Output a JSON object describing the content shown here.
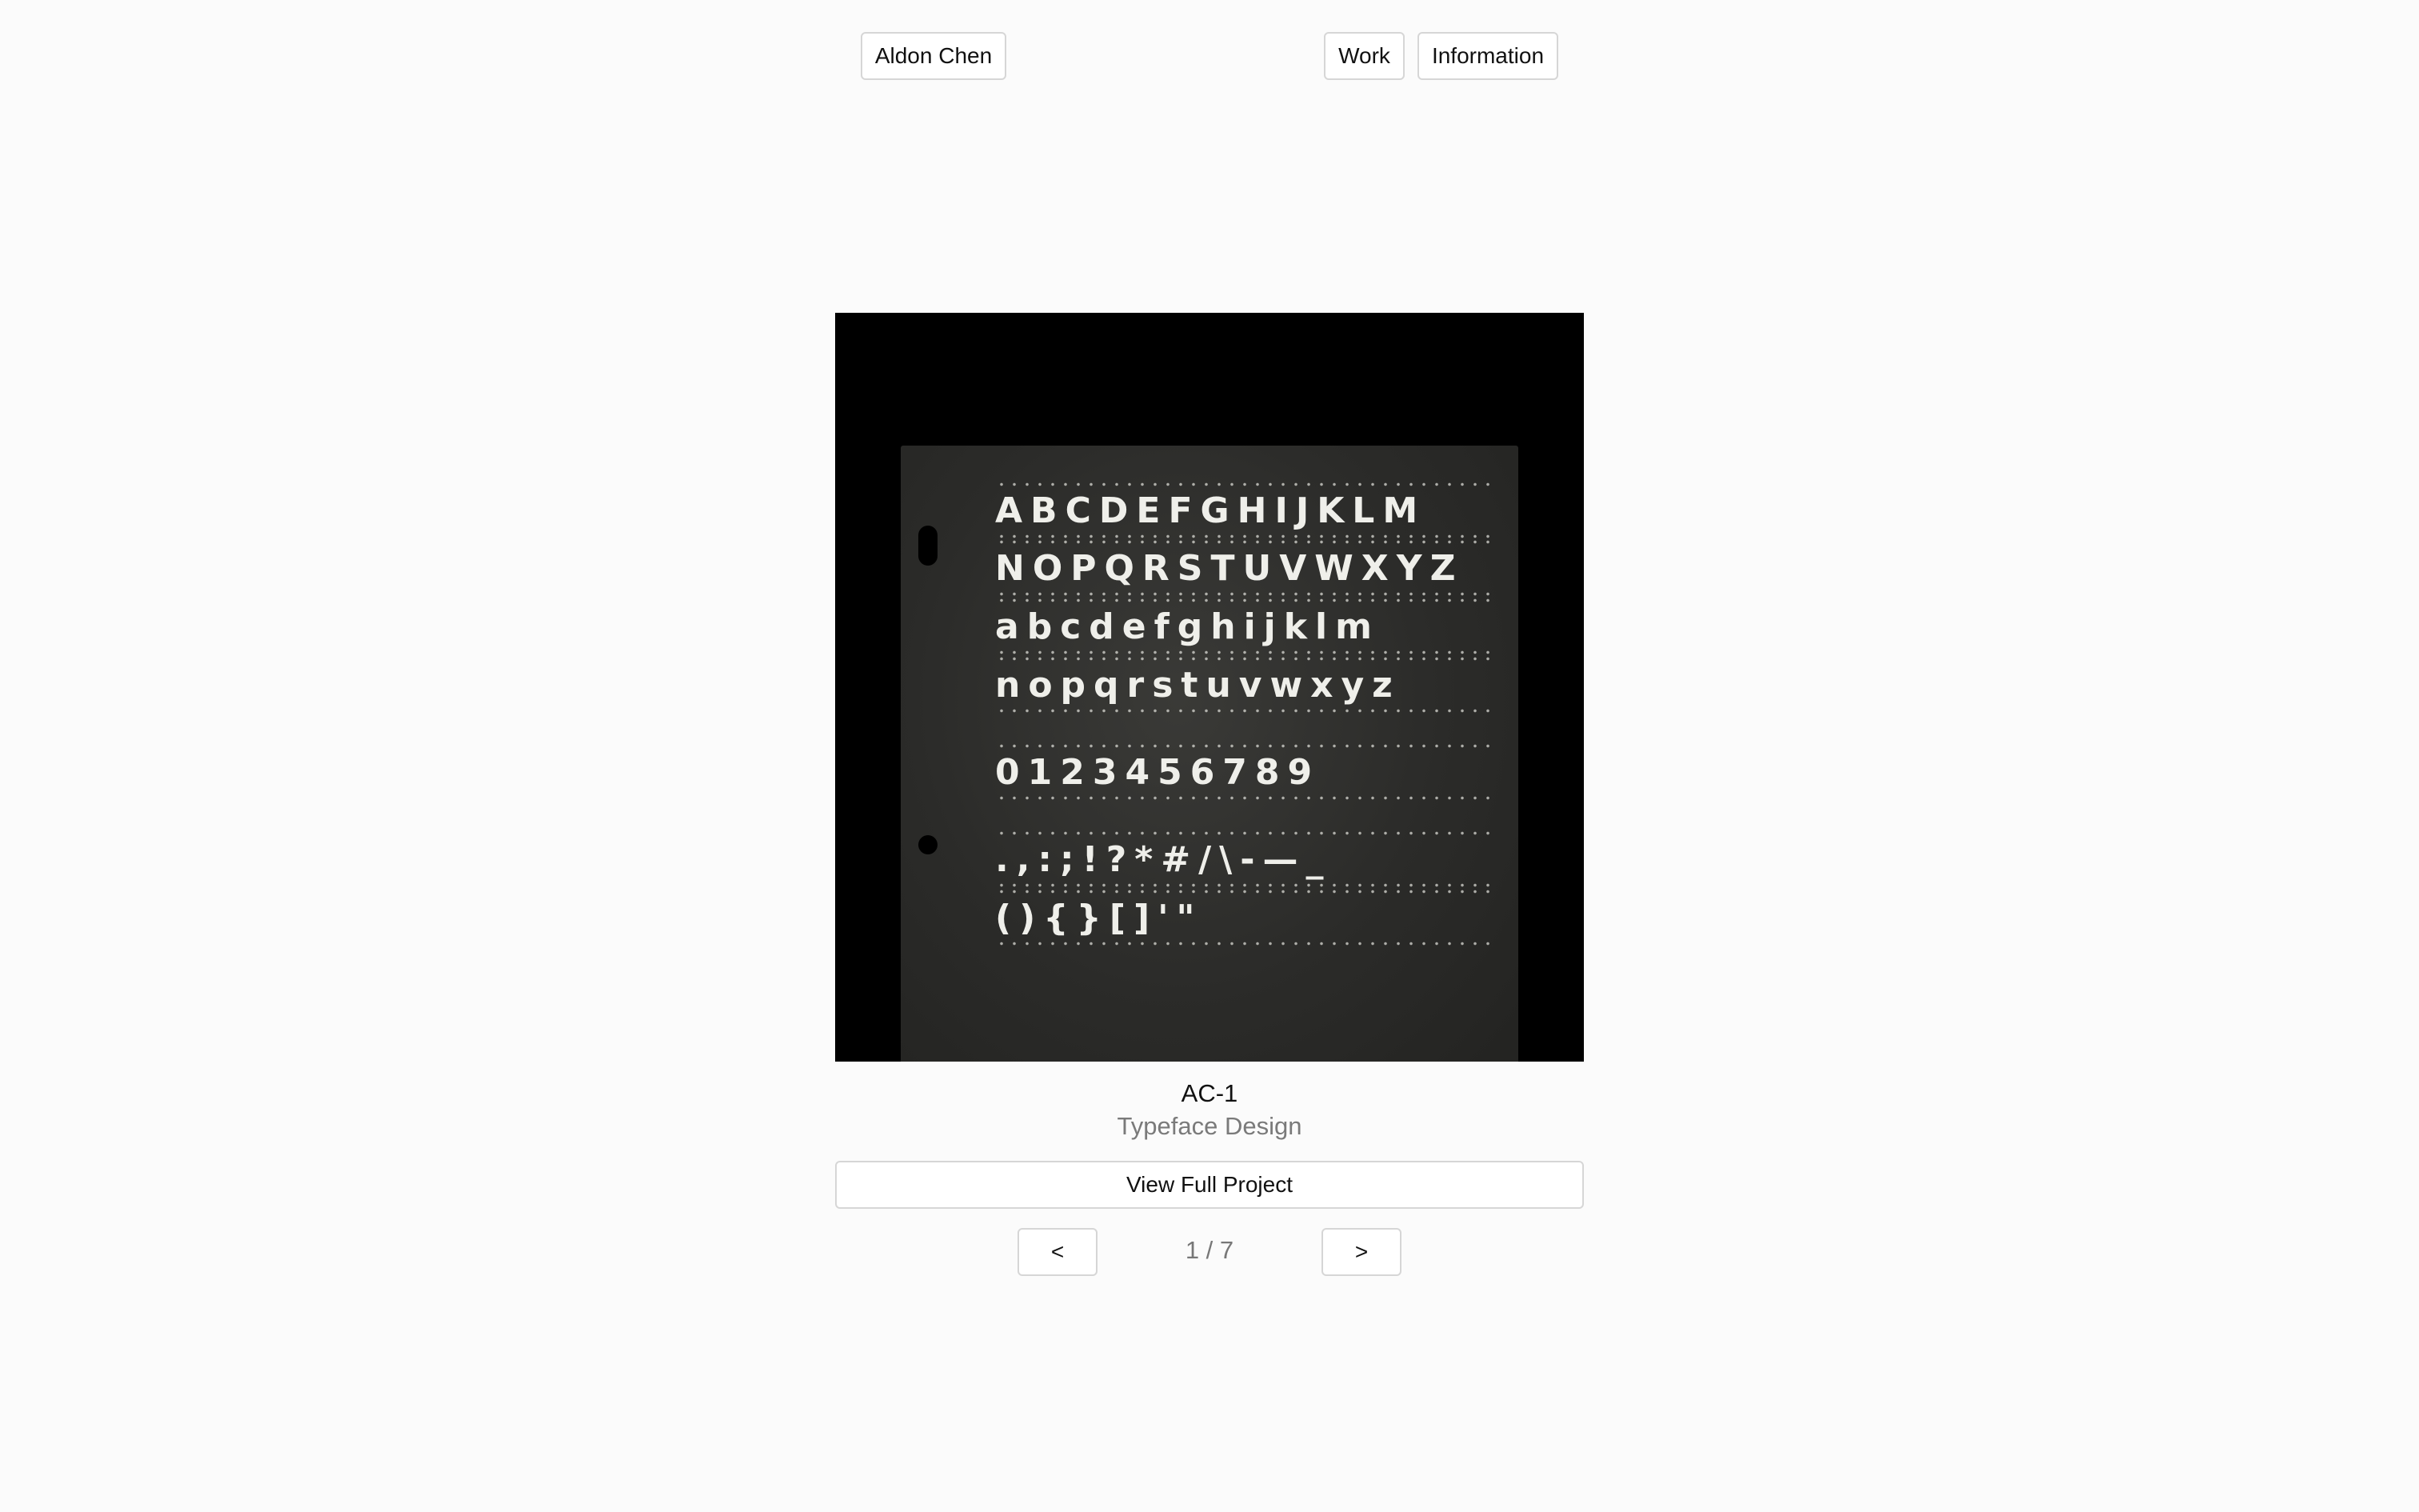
{
  "header": {
    "site_name": "Aldon Chen",
    "nav": {
      "work_label": "Work",
      "information_label": "Information"
    }
  },
  "hero": {
    "specimen_rows": {
      "upper_1": "ABCDEFGHIJKLM",
      "upper_2": "NOPQRSTUVWXYZ",
      "lower_1": "abcdefghijklm",
      "lower_2": "nopqrstuvwxyz",
      "digits": "0123456789",
      "punct_1": ".,:;!?*#/\\-—_",
      "punct_2": "(){}[]'\""
    }
  },
  "project": {
    "title": "AC-1",
    "category": "Typeface Design",
    "view_label": "View Full Project"
  },
  "pagination": {
    "prev_label": "<",
    "next_label": ">",
    "counter": "1 / 7"
  }
}
